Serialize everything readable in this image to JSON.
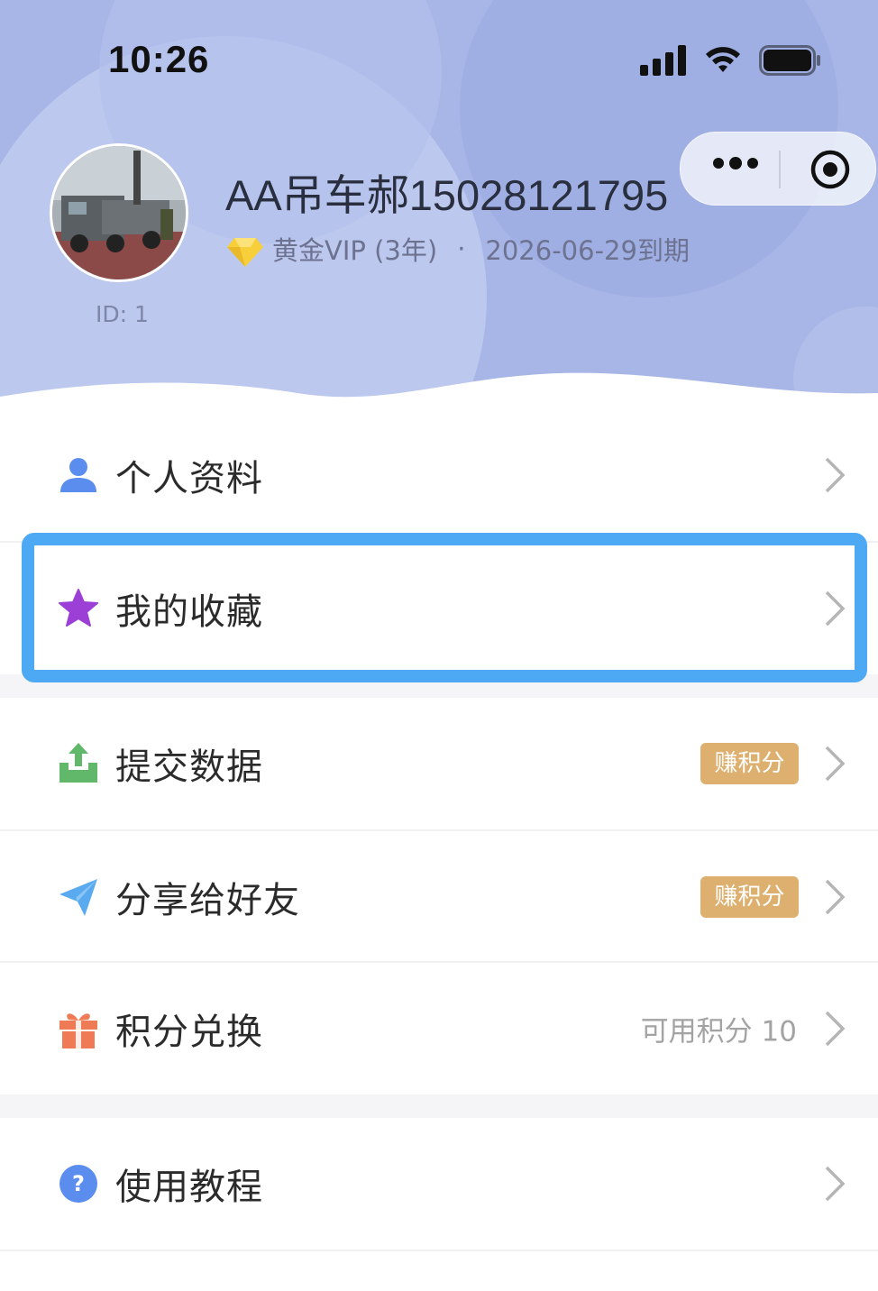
{
  "status_bar": {
    "time": "10:26"
  },
  "profile": {
    "username": "AA吊车郝15028121795",
    "id_label": "ID: 1",
    "vip_level": "黄金VIP (3年)",
    "separator": "·",
    "expiry": "2026-06-29到期"
  },
  "menu": [
    {
      "label": "个人资料",
      "icon": "person-icon"
    },
    {
      "label": "我的收藏",
      "icon": "star-icon"
    },
    {
      "label": "提交数据",
      "icon": "upload-icon",
      "badge": "赚积分"
    },
    {
      "label": "分享给好友",
      "icon": "paper-plane-icon",
      "badge": "赚积分"
    },
    {
      "label": "积分兑换",
      "icon": "gift-icon",
      "right_text": "可用积分 10"
    },
    {
      "label": "使用教程",
      "icon": "help-icon"
    }
  ],
  "colors": {
    "header_bg": "#a3b3e4",
    "highlight": "#4ea9f5",
    "badge": "#ddb070",
    "person_icon": "#5b8def",
    "star_icon": "#9b3fd6",
    "upload_icon": "#62b86a",
    "plane_icon": "#5aaaf0",
    "gift_icon": "#ee7b55",
    "help_icon": "#5b8def"
  }
}
